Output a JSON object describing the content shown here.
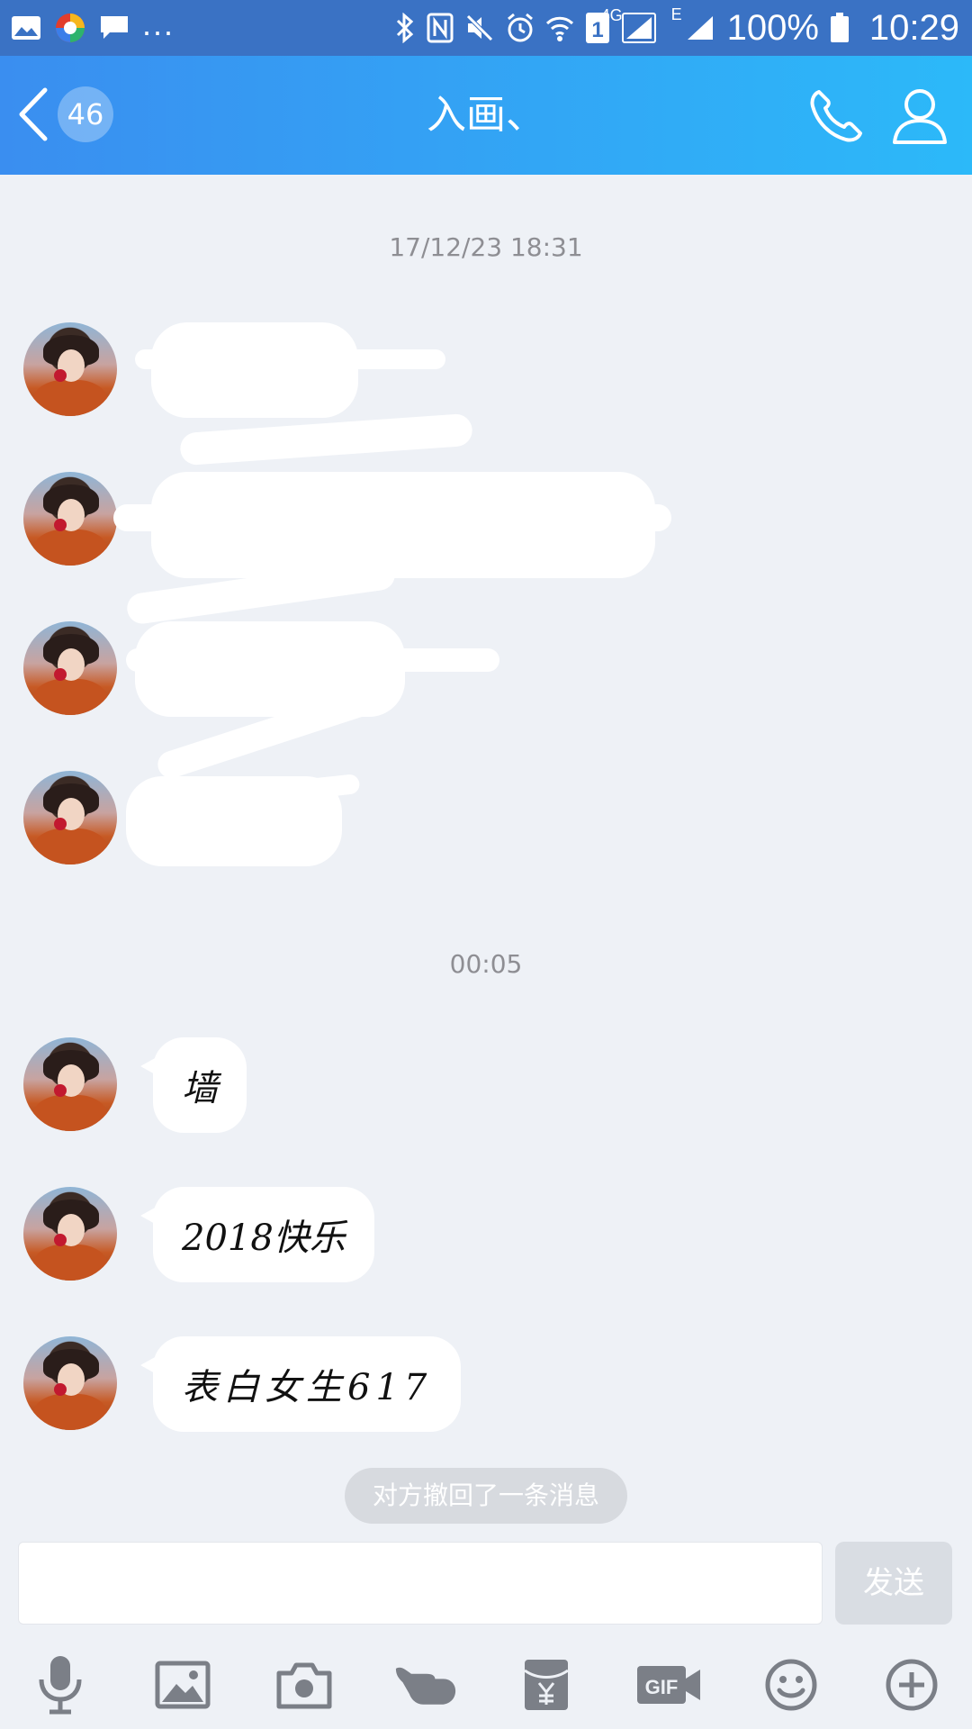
{
  "status_bar": {
    "dots": "...",
    "network_4g": "4G",
    "network_e": "E",
    "sim": "1",
    "battery_percent": "100%",
    "time": "10:29"
  },
  "header": {
    "unread_count": "46",
    "title": "入画、"
  },
  "chat": {
    "timestamp_1": "17/12/23 18:31",
    "timestamp_2": "00:05",
    "messages": [
      {
        "text": "墙"
      },
      {
        "text": "2018快乐"
      },
      {
        "text": "表白女生617"
      }
    ],
    "recall_notice": "对方撤回了一条消息"
  },
  "input": {
    "value": "",
    "send_label": "发送"
  },
  "toolbar": {
    "icons": [
      "microphone-icon",
      "image-icon",
      "camera-icon",
      "poke-icon",
      "red-packet-icon",
      "gif-icon",
      "emoji-icon",
      "plus-icon"
    ]
  }
}
